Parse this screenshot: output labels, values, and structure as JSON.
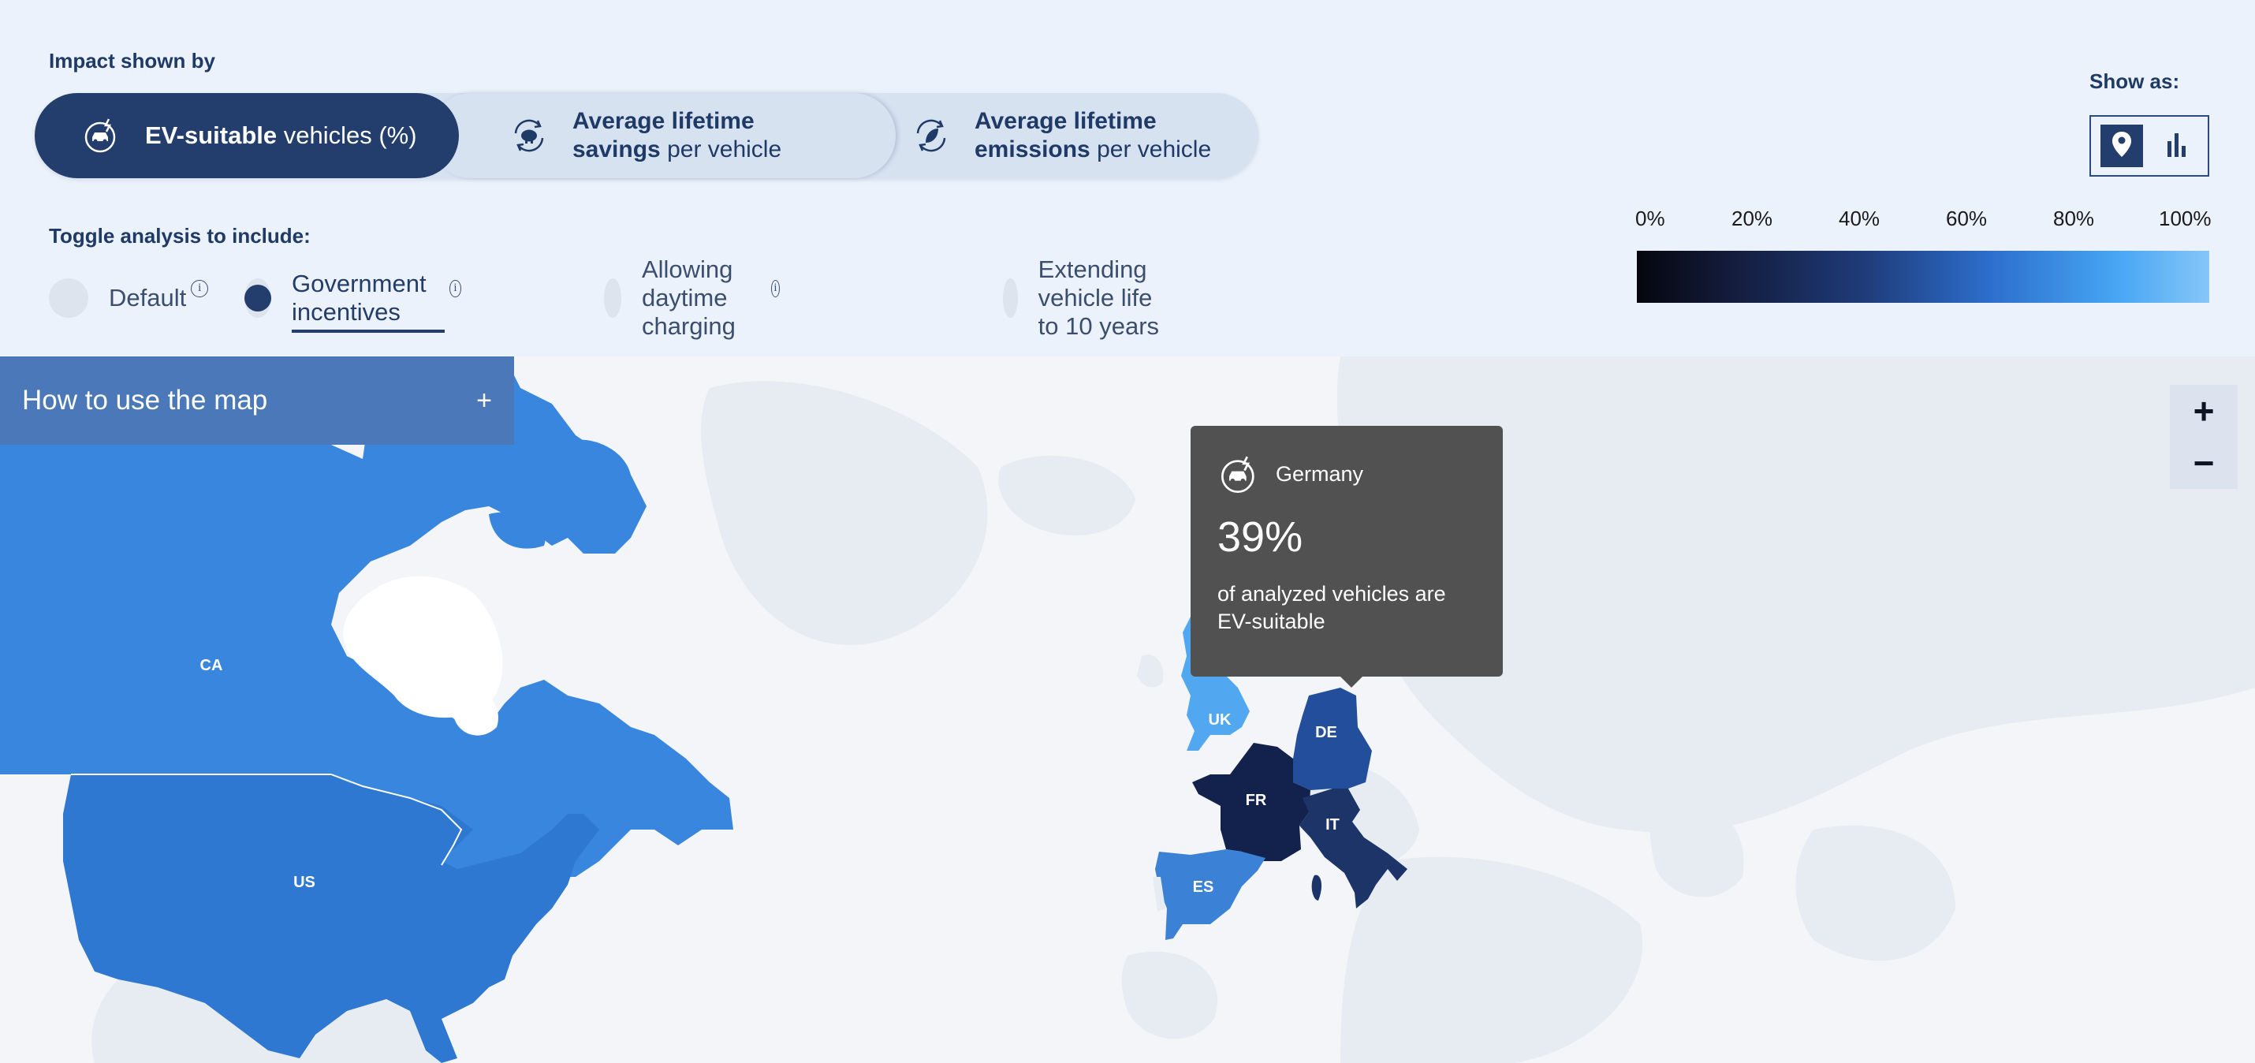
{
  "impact": {
    "label": "Impact shown by",
    "tabs": [
      {
        "bold": "EV-suitable",
        "rest": " vehicles (%)",
        "icon": "ev-car-icon",
        "active": true
      },
      {
        "bold": "Average lifetime",
        "bold2": "savings",
        "rest": " per vehicle",
        "icon": "piggy-bank-cycle-icon",
        "active": false
      },
      {
        "bold": "Average lifetime",
        "bold2": "emissions",
        "rest": " per vehicle",
        "icon": "leaf-cycle-icon",
        "active": false
      }
    ]
  },
  "toggles": {
    "label": "Toggle analysis to include:",
    "items": [
      {
        "label": "Default",
        "info": "i",
        "selected": false
      },
      {
        "label": "Government incentives",
        "info": "i",
        "selected": true
      },
      {
        "label": "Allowing daytime charging",
        "info": "i",
        "selected": false
      },
      {
        "label": "Extending vehicle life to 10 years",
        "selected": false
      }
    ]
  },
  "show_as": {
    "label": "Show as:",
    "options": [
      {
        "icon": "map-pin-icon",
        "selected": true
      },
      {
        "icon": "bar-chart-icon",
        "selected": false
      }
    ]
  },
  "legend": {
    "ticks": [
      "0%",
      "20%",
      "40%",
      "60%",
      "80%",
      "100%"
    ],
    "colors": [
      "#05070e",
      "#1f3c7a",
      "#2d6fcd",
      "#47a6f4",
      "#86c6f7"
    ]
  },
  "howto": {
    "label": "How to use the map",
    "toggle": "+"
  },
  "zoom": {
    "in": "+",
    "out": "−"
  },
  "tooltip": {
    "icon": "ev-car-icon",
    "country": "Germany",
    "value": "39%",
    "description": "of analyzed vehicles are EV-suitable"
  },
  "countries": [
    {
      "code": "CA",
      "color": "#3886dd"
    },
    {
      "code": "US",
      "color": "#2f78d1"
    },
    {
      "code": "UK",
      "color": "#52a7f1"
    },
    {
      "code": "DE",
      "color": "#234e9c"
    },
    {
      "code": "FR",
      "color": "#13224d"
    },
    {
      "code": "IT",
      "color": "#1d3469"
    },
    {
      "code": "ES",
      "color": "#3b82d6"
    }
  ]
}
